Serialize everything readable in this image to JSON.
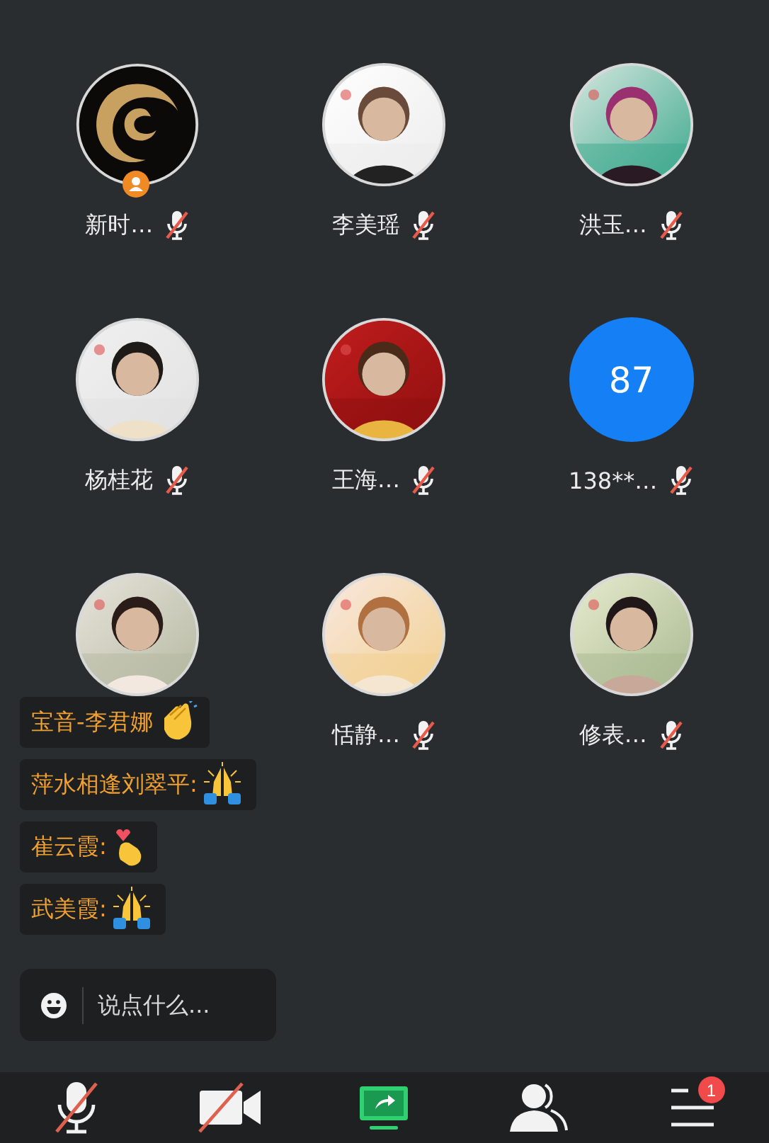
{
  "participants": [
    {
      "name": "新时…",
      "avatar": {
        "kind": "logo"
      },
      "host": true,
      "muted": true
    },
    {
      "name": "李美瑶",
      "avatar": {
        "kind": "picture"
      },
      "muted": true
    },
    {
      "name": "洪玉…",
      "avatar": {
        "kind": "picture"
      },
      "muted": true
    },
    {
      "name": "杨桂花",
      "avatar": {
        "kind": "picture"
      },
      "muted": true
    },
    {
      "name": "王海…",
      "avatar": {
        "kind": "picture"
      },
      "muted": true
    },
    {
      "name": "138**…",
      "avatar": {
        "kind": "number",
        "label": "87"
      },
      "muted": true
    },
    {
      "avatar": {
        "kind": "picture"
      }
    },
    {
      "name": "恬静…",
      "avatar": {
        "kind": "picture"
      },
      "muted": true
    },
    {
      "name": "修表…",
      "avatar": {
        "kind": "picture"
      },
      "muted": true
    }
  ],
  "chat": {
    "messages": [
      {
        "text": "宝音-李君娜",
        "kind": "clap"
      },
      {
        "text": "萍水相逢刘翠平:",
        "kind": "pray"
      },
      {
        "text": "崔云霞:",
        "kind": "heart"
      },
      {
        "text": "武美霞:",
        "kind": "pray"
      }
    ],
    "input": {
      "placeholder": "说点什么..."
    }
  },
  "toolbar": [
    {
      "kind": "mic",
      "muted": true
    },
    {
      "kind": "camera",
      "muted": true
    },
    {
      "kind": "share"
    },
    {
      "kind": "people"
    },
    {
      "kind": "menu",
      "badge": "1"
    }
  ]
}
